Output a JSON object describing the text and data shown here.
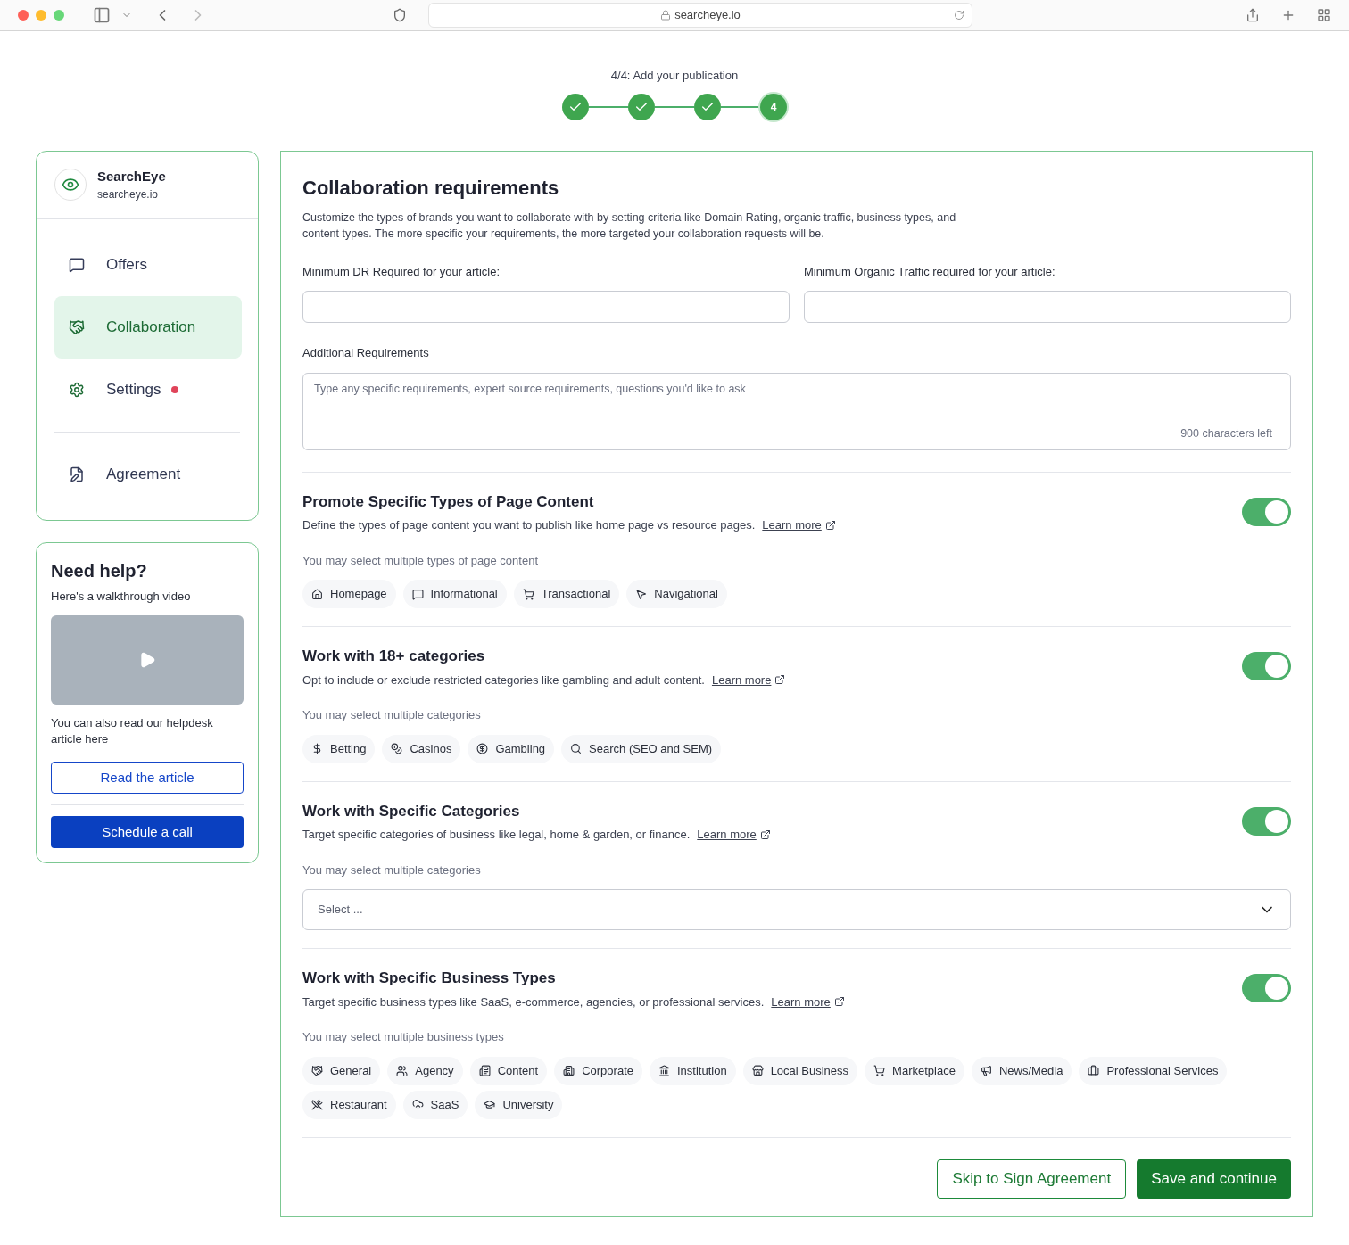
{
  "browser": {
    "url": "searcheye.io"
  },
  "stepper": {
    "title": "4/4: Add your publication",
    "steps": [
      {
        "done": true
      },
      {
        "done": true
      },
      {
        "done": true
      },
      {
        "done": false,
        "label": "4"
      }
    ]
  },
  "profile": {
    "name": "SearchEye",
    "domain": "searcheye.io"
  },
  "nav": [
    {
      "label": "Offers",
      "kind": "offers",
      "selected": false,
      "alert": false
    },
    {
      "label": "Collaboration",
      "kind": "collab",
      "selected": true,
      "alert": false
    },
    {
      "label": "Settings",
      "kind": "settings",
      "selected": false,
      "alert": true
    }
  ],
  "nav_footer": [
    {
      "label": "Agreement",
      "kind": "agreement",
      "selected": false,
      "alert": false
    }
  ],
  "help": {
    "title": "Need help?",
    "subtitle": "Here's a walkthrough video",
    "note": "You can also read our helpdesk article here",
    "article_button": "Read the article",
    "call_button": "Schedule a call"
  },
  "main": {
    "title": "Collaboration requirements",
    "description": "Customize the types of brands you want to collaborate with by setting criteria like Domain Rating, organic traffic, business types, and content types. The more specific your requirements, the more targeted your collaboration requests will be.",
    "fields": [
      {
        "label": "Minimum DR Required for your article:"
      },
      {
        "label": "Minimum Organic Traffic required for your article:"
      }
    ],
    "textarea": {
      "label": "Additional Requirements",
      "placeholder": "Type any specific requirements, expert source requirements, questions you'd like to ask",
      "counter": "900 characters left"
    }
  },
  "sections": [
    {
      "title": "Promote Specific Types of Page Content",
      "description": "Define the types of page content you want to publish like home page vs resource pages.",
      "link": "Learn more",
      "on": true,
      "hint": "You may select multiple types of page content",
      "kind": "chips",
      "chips": [
        {
          "label": "Homepage",
          "kind": "home",
          "selected": false
        },
        {
          "label": "Informational",
          "kind": "message",
          "selected": false
        },
        {
          "label": "Transactional",
          "kind": "cart",
          "selected": false
        },
        {
          "label": "Navigational",
          "kind": "pointer",
          "selected": false
        }
      ]
    },
    {
      "title": "Work with 18+ categories",
      "description": "Opt to include or exclude restricted categories like gambling and adult content.",
      "link": "Learn more",
      "on": true,
      "hint": "You may select multiple categories",
      "kind": "chips",
      "chips": [
        {
          "label": "Betting",
          "kind": "dollar",
          "selected": false
        },
        {
          "label": "Casinos",
          "kind": "coins",
          "selected": false
        },
        {
          "label": "Gambling",
          "kind": "coin",
          "selected": false
        },
        {
          "label": "Search (SEO and SEM)",
          "kind": "search",
          "selected": false
        }
      ]
    },
    {
      "title": "Work with Specific Categories",
      "description": "Target specific categories of business like legal, home & garden, or finance.",
      "link": "Learn more",
      "on": true,
      "hint": "You may select multiple categories",
      "kind": "select",
      "placeholder": "Select ..."
    },
    {
      "title": "Work with Specific Business Types",
      "description": "Target specific business types like SaaS, e-commerce, agencies, or professional services.",
      "link": "Learn more",
      "on": true,
      "hint": "You may select multiple business types",
      "kind": "chips",
      "chips": [
        {
          "label": "General",
          "kind": "handshake",
          "selected": false
        },
        {
          "label": "Agency",
          "kind": "users",
          "selected": false
        },
        {
          "label": "Content",
          "kind": "news",
          "selected": false
        },
        {
          "label": "Corporate",
          "kind": "building",
          "selected": false
        },
        {
          "label": "Institution",
          "kind": "landmark",
          "selected": false
        },
        {
          "label": "Local Business",
          "kind": "store",
          "selected": false
        },
        {
          "label": "Marketplace",
          "kind": "cart",
          "selected": false
        },
        {
          "label": "News/Media",
          "kind": "megaphone",
          "selected": false
        },
        {
          "label": "Professional Services",
          "kind": "briefcase",
          "selected": false
        },
        {
          "label": "Restaurant",
          "kind": "utensils",
          "selected": false
        },
        {
          "label": "SaaS",
          "kind": "cloud",
          "selected": false
        },
        {
          "label": "University",
          "kind": "cap",
          "selected": false
        }
      ]
    }
  ],
  "actions": {
    "skip": "Skip to Sign Agreement",
    "save": "Save and continue"
  }
}
